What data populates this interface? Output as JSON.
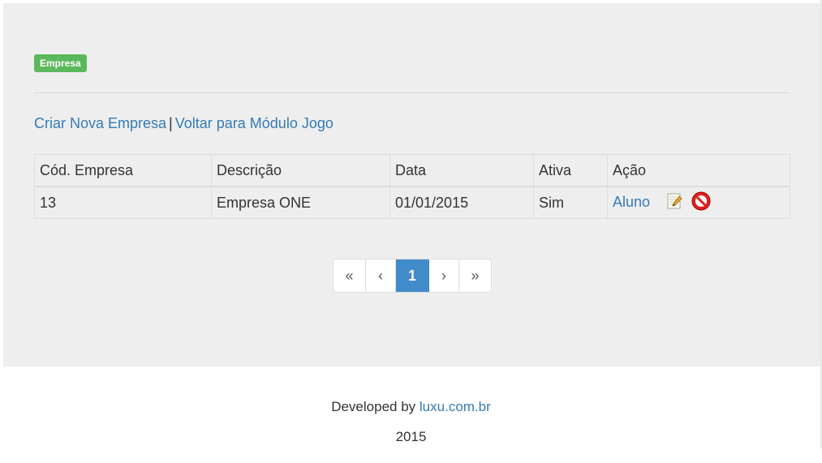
{
  "header": {
    "badge": "Empresa"
  },
  "actions": {
    "create_label": "Criar Nova Empresa",
    "separator": "|",
    "back_label": "Voltar para Módulo Jogo"
  },
  "table": {
    "columns": [
      "Cód. Empresa",
      "Descrição",
      "Data",
      "Ativa",
      "Ação"
    ],
    "rows": [
      {
        "cod": "13",
        "descricao": "Empresa ONE",
        "data": "01/01/2015",
        "ativa": "Sim",
        "acao_link": "Aluno",
        "icons": [
          "edit-icon",
          "delete-icon"
        ]
      }
    ]
  },
  "pagination": {
    "first": "«",
    "prev": "‹",
    "current": "1",
    "next": "›",
    "last": "»",
    "active_color": "#428bca"
  },
  "footer": {
    "developed_by": "Developed by",
    "site": "luxu.com.br",
    "year": "2015"
  },
  "colors": {
    "badge": "#5cb85c",
    "link": "#337ab7",
    "panel": "#eeeeee"
  }
}
